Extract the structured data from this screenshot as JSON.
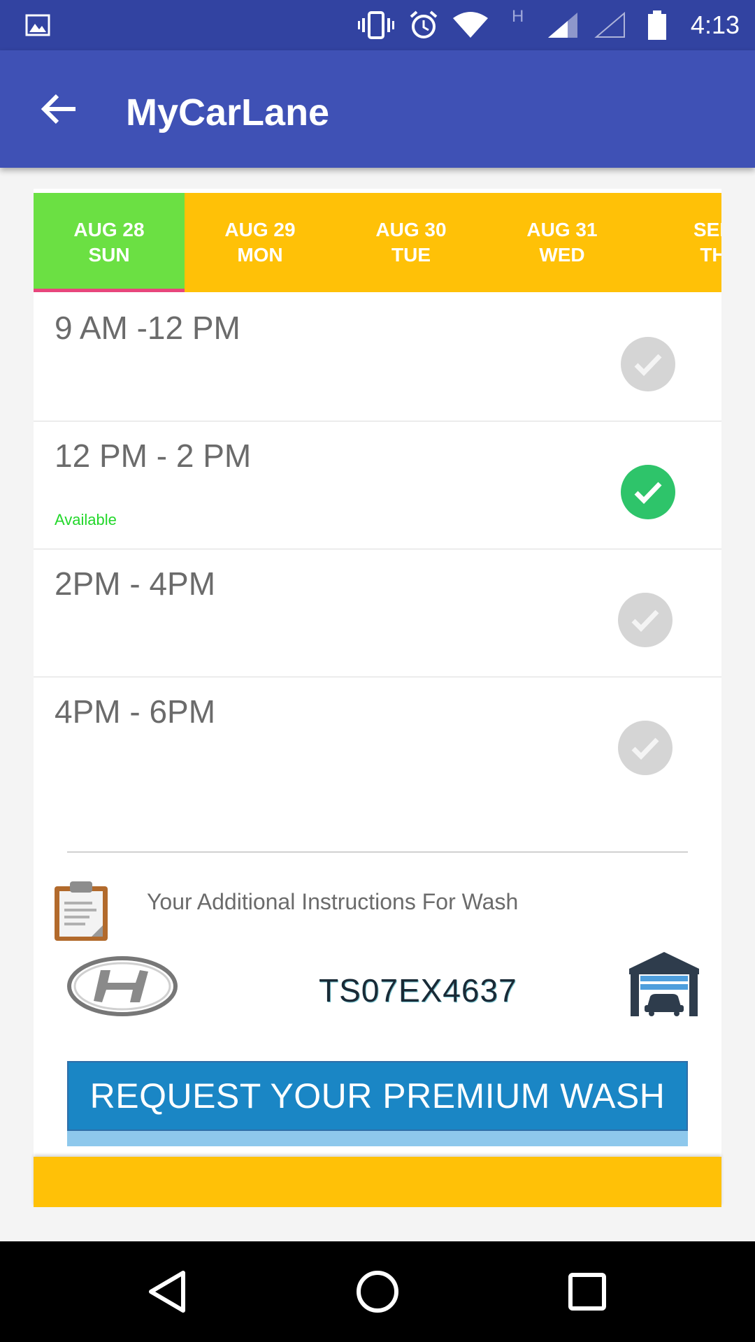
{
  "status_bar": {
    "time": "4:13",
    "icons": [
      "image-icon",
      "vibrate-icon",
      "alarm-icon",
      "wifi-icon",
      "h-network-icon",
      "signal-icon",
      "signal-empty-icon",
      "battery-icon"
    ],
    "network_type": "H"
  },
  "app_bar": {
    "title": "MyCarLane",
    "back_icon": "arrow-back-icon"
  },
  "date_tabs": [
    {
      "date": "AUG 28",
      "day": "SUN",
      "selected": true
    },
    {
      "date": "AUG 29",
      "day": "MON",
      "selected": false
    },
    {
      "date": "AUG 30",
      "day": "TUE",
      "selected": false
    },
    {
      "date": "AUG 31",
      "day": "WED",
      "selected": false
    },
    {
      "date": "SEP",
      "day": "TH",
      "selected": false
    }
  ],
  "slots": [
    {
      "time": "9 AM -12 PM",
      "status": "",
      "selected": false
    },
    {
      "time": "12 PM - 2 PM",
      "status": "Available",
      "selected": true
    },
    {
      "time": "2PM - 4PM",
      "status": "",
      "selected": false
    },
    {
      "time": "4PM - 6PM",
      "status": "",
      "selected": false
    }
  ],
  "instructions": {
    "label": "Your Additional Instructions For Wash",
    "icon": "clipboard-icon"
  },
  "vehicle": {
    "brand_icon": "hyundai-logo-icon",
    "plate": "TS07EX4637",
    "garage_icon": "garage-icon"
  },
  "request_button": {
    "label": "REQUEST YOUR PREMIUM WASH"
  },
  "colors": {
    "status_bar": "#3243a1",
    "app_bar": "#3f51b5",
    "tabs_bg": "#ffc107",
    "tab_selected": "#6be043",
    "tab_indicator": "#e8467c",
    "available": "#22d72a",
    "check_on": "#2ec46a",
    "check_off": "#d5d5d5",
    "button": "#1a86c5"
  },
  "nav_bar": {
    "icons": [
      "nav-back-icon",
      "nav-home-icon",
      "nav-recents-icon"
    ]
  }
}
